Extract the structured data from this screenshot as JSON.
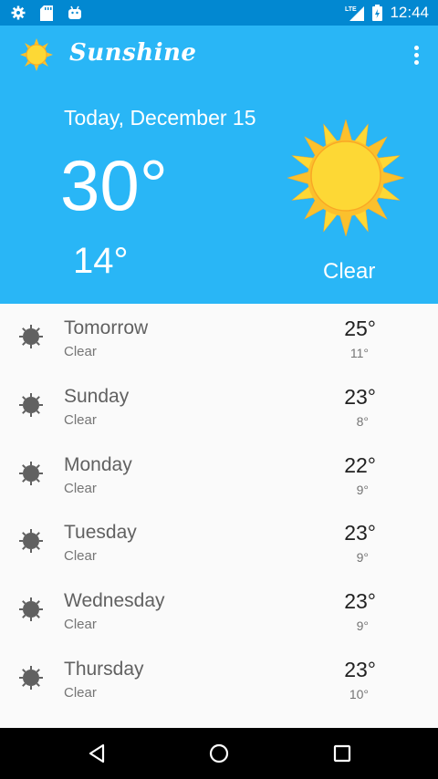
{
  "status_bar": {
    "time": "12:44",
    "network": "LTE",
    "icons": [
      "settings-icon",
      "sd-card-icon",
      "android-icon",
      "signal-icon",
      "battery-icon"
    ]
  },
  "app_bar": {
    "title": "Sunshine",
    "logo": "sun-icon",
    "menu_icon": "overflow-menu-icon"
  },
  "today": {
    "date": "Today, December 15",
    "high": "30°",
    "low": "14°",
    "description": "Clear",
    "icon": "sun-icon"
  },
  "forecast": [
    {
      "day": "Tomorrow",
      "description": "Clear",
      "high": "25°",
      "low": "11°"
    },
    {
      "day": "Sunday",
      "description": "Clear",
      "high": "23°",
      "low": "8°"
    },
    {
      "day": "Monday",
      "description": "Clear",
      "high": "22°",
      "low": "9°"
    },
    {
      "day": "Tuesday",
      "description": "Clear",
      "high": "23°",
      "low": "9°"
    },
    {
      "day": "Wednesday",
      "description": "Clear",
      "high": "23°",
      "low": "9°"
    },
    {
      "day": "Thursday",
      "description": "Clear",
      "high": "23°",
      "low": "10°"
    }
  ],
  "nav_bar": {
    "buttons": [
      "back-icon",
      "home-icon",
      "recents-icon"
    ]
  },
  "colors": {
    "primary": "#29b6f6",
    "primary_dark": "#0288d1",
    "sun_yellow": "#fdd835",
    "sun_rays": "#fbc02d",
    "list_icon": "#616161"
  }
}
